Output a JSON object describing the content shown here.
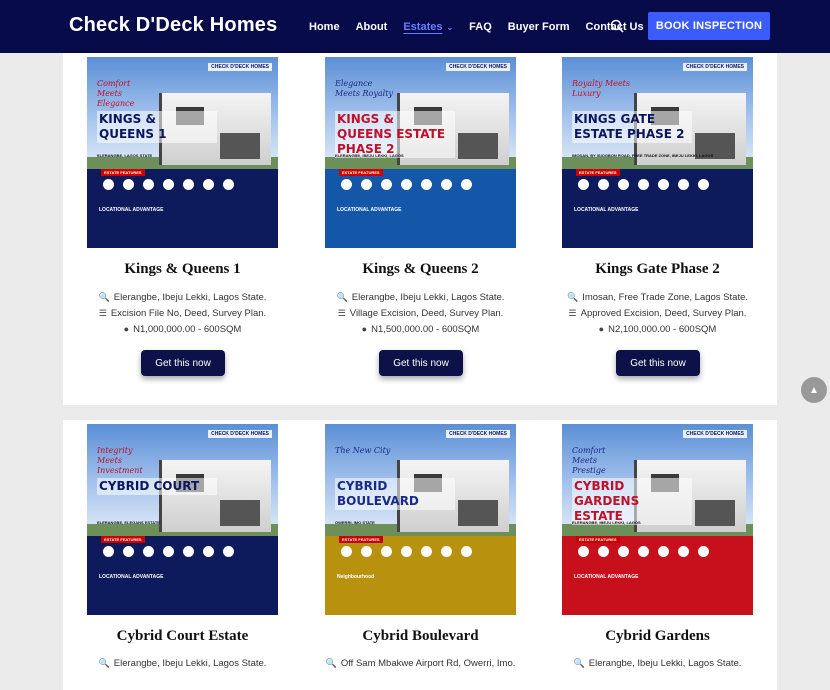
{
  "header": {
    "brand": "Check D'Deck Homes",
    "menu": [
      {
        "label": "Home",
        "active": false
      },
      {
        "label": "About",
        "active": false
      },
      {
        "label": "Estates",
        "active": true
      },
      {
        "label": "FAQ",
        "active": false
      },
      {
        "label": "Buyer Form",
        "active": false
      },
      {
        "label": "Contact Us",
        "active": false
      }
    ],
    "search_icon": "search-icon",
    "cta": "BOOK INSPECTION"
  },
  "colors": {
    "nav_bg": "#070b4a",
    "cta_bg": "#3b5bfd",
    "button_bg": "#0c1148",
    "accent": "#6d7cff"
  },
  "cards": [
    {
      "title": "Kings & Queens 1",
      "location": "Elerangbe, Ibeju Lekki, Lagos State.",
      "documents": "Excision File No, Deed, Survey Plan.",
      "price": "N1,000,000.00 - 600SQM",
      "button": "Get this now",
      "flyer": {
        "tagline": "Comfort Meets Elegance",
        "name": "KINGS & QUEENS 1",
        "subtitle": "ELERANGBE, LAGOS STATE",
        "theme": "navy",
        "features": "ESTATE FEATURES",
        "advantage": "LOCATIONAL ADVANTAGE"
      }
    },
    {
      "title": "Kings & Queens 2",
      "location": "Elerangbe, Ibeju Lekki, Lagos State.",
      "documents": "Village Excision, Deed, Survey Plan.",
      "price": "N1,500,000.00 - 600SQM",
      "button": "Get this now",
      "flyer": {
        "tagline": "Elegance Meets Royalty",
        "name": "KINGS & QUEENS ESTATE PHASE 2",
        "subtitle": "ELERANGBE, IBEJU LEKKI, LAGOS",
        "theme": "blue",
        "features": "ESTATE FEATURES",
        "advantage": "LOCATIONAL ADVANTAGE"
      }
    },
    {
      "title": "Kings Gate Phase 2",
      "location": "Imosan, Free Trade Zone, Lagos State.",
      "documents": "Approved Excision, Deed, Survey Plan.",
      "price": "N2,100,000.00 - 600SQM",
      "button": "Get this now",
      "flyer": {
        "tagline": "Royalty Meets Luxury",
        "name": "KINGS GATE ESTATE PHASE 2",
        "subtitle": "IMOSAN, BY ISIOGBON ROAD, FREE TRADE ZONE, IBEJU LEKKI, LAGOS",
        "theme": "navy",
        "features": "ESTATE FEATURES",
        "advantage": "LOCATIONAL ADVANTAGE"
      }
    },
    {
      "title": "Cybrid Court Estate",
      "location": "Elerangbe, Ibeju Lekki, Lagos State.",
      "flyer": {
        "tagline": "Integrity Meets Investment",
        "name": "CYBRID COURT",
        "subtitle": "ELERANGBE, ELEGANS ESTATE",
        "theme": "navy",
        "features": "ESTATE FEATURES",
        "advantage": "LOCATIONAL ADVANTAGE"
      }
    },
    {
      "title": "Cybrid Boulevard",
      "location": "Off Sam Mbakwe Airport Rd, Owerri, Imo.",
      "flyer": {
        "tagline": "The New City",
        "name": "CYBRID BOULEVARD",
        "subtitle": "OWERRI, IMO STATE",
        "theme": "gold",
        "features": "ESTATE FEATURES",
        "advantage": "Neighbourhood"
      }
    },
    {
      "title": "Cybrid Gardens",
      "location": "Elerangbe, Ibeju Lekki, Lagos State.",
      "flyer": {
        "tagline": "Comfort Meets Prestige",
        "name": "CYBRID GARDENS ESTATE",
        "subtitle": "ELERANGBE, IBEJU LEKKI, LAGOS",
        "theme": "red",
        "features": "ESTATE FEATURES",
        "advantage": "LOCATIONAL ADVANTAGE"
      }
    }
  ],
  "flyer_logo": "CHECK D'DECK HOMES",
  "scroll_top_icon": "chevron-up-icon"
}
